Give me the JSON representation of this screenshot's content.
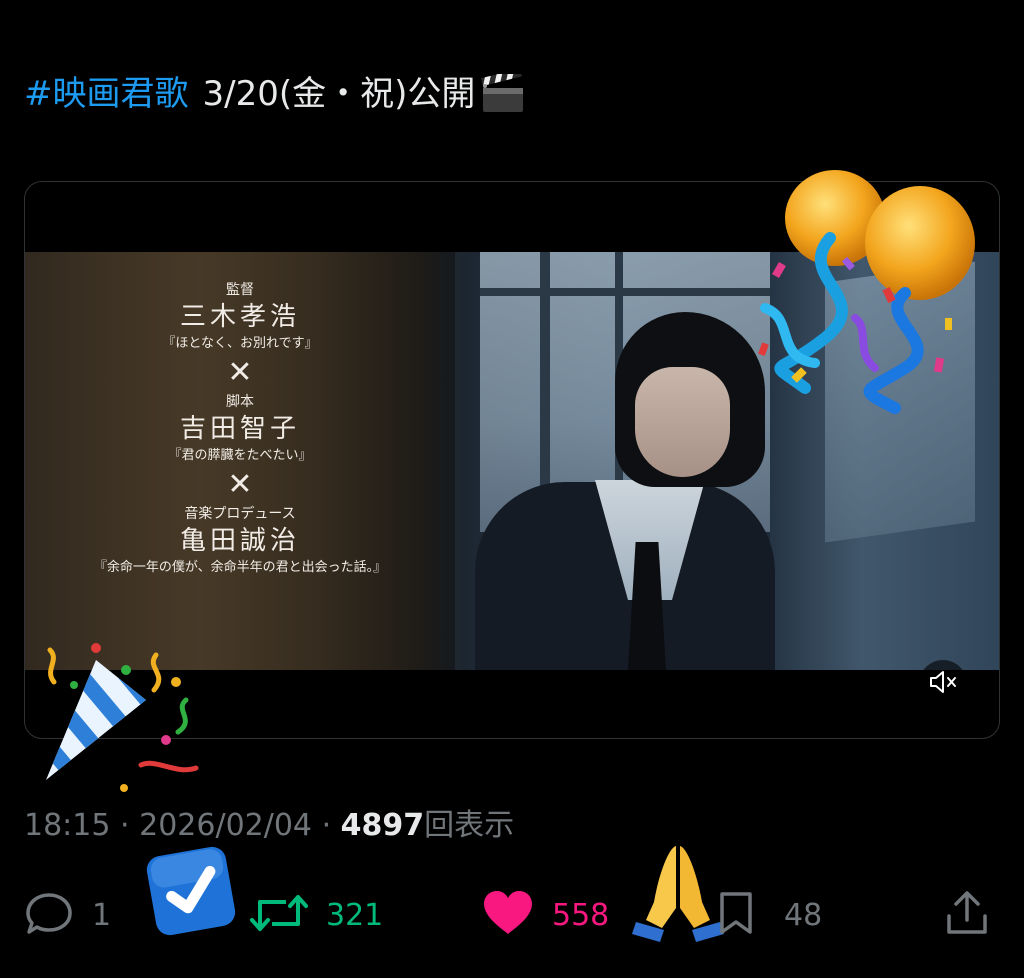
{
  "post": {
    "hashtag": "#映画君歌",
    "text": "3/20(金・祝)公開"
  },
  "video": {
    "credits": [
      {
        "role": "監督",
        "name": "三木孝浩",
        "work": "『ほとなく、お別れです』"
      },
      {
        "role": "脚本",
        "name": "吉田智子",
        "work": "『君の膵臓をたべたい』"
      },
      {
        "role": "音楽プロデュース",
        "name": "亀田誠治",
        "work": "『余命一年の僕が、余命半年の君と出会った話。』"
      }
    ],
    "separator": "✕",
    "muted": true
  },
  "meta": {
    "time": "18:15",
    "dot": "·",
    "date": "2026/02/04",
    "views_count": "4897",
    "views_label": "回表示"
  },
  "actions": {
    "replies": "1",
    "retweets": "321",
    "likes": "558",
    "bookmarks": "48"
  },
  "colors": {
    "hashtag": "#1d9bf0",
    "retweet": "#00ba7c",
    "like": "#f91880",
    "muted_text": "#71767b",
    "text": "#e7e9ea"
  },
  "icons": [
    "clapperboard-icon",
    "mute-icon",
    "reply-icon",
    "retweet-icon",
    "like-icon",
    "bookmark-icon",
    "share-icon",
    "balloons-sticker",
    "party-popper-sticker",
    "checkmark-sticker",
    "praying-hands-sticker"
  ]
}
